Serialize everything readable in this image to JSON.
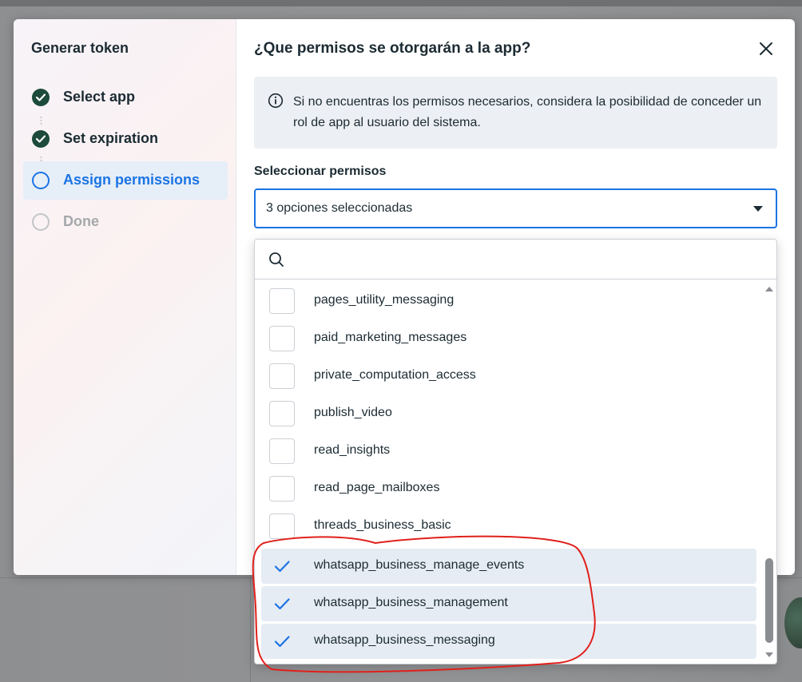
{
  "sidebar": {
    "title": "Generar token",
    "steps": [
      {
        "label": "Select app",
        "state": "done"
      },
      {
        "label": "Set expiration",
        "state": "done"
      },
      {
        "label": "Assign permissions",
        "state": "active"
      },
      {
        "label": "Done",
        "state": "pending"
      }
    ]
  },
  "dialog": {
    "title": "¿Que permisos se otorgarán a la app?",
    "close_icon": "close-icon",
    "info_text": "Si no encuentras los permisos necesarios, considera la posibilidad de conceder un rol de app al usuario del sistema.",
    "select_label": "Seleccionar permisos",
    "select_value": "3 opciones seleccionadas"
  },
  "dropdown": {
    "search_value": "",
    "options": [
      {
        "label": "pages_utility_messaging",
        "checked": false
      },
      {
        "label": "paid_marketing_messages",
        "checked": false
      },
      {
        "label": "private_computation_access",
        "checked": false
      },
      {
        "label": "publish_video",
        "checked": false
      },
      {
        "label": "read_insights",
        "checked": false
      },
      {
        "label": "read_page_mailboxes",
        "checked": false
      },
      {
        "label": "threads_business_basic",
        "checked": false
      },
      {
        "label": "whatsapp_business_manage_events",
        "checked": true
      },
      {
        "label": "whatsapp_business_management",
        "checked": true
      },
      {
        "label": "whatsapp_business_messaging",
        "checked": true
      }
    ]
  },
  "colors": {
    "accent": "#1b74e4",
    "done_step": "#1c4a3b",
    "checked_row": "#e6ecf4",
    "annotation": "#e0201b"
  }
}
